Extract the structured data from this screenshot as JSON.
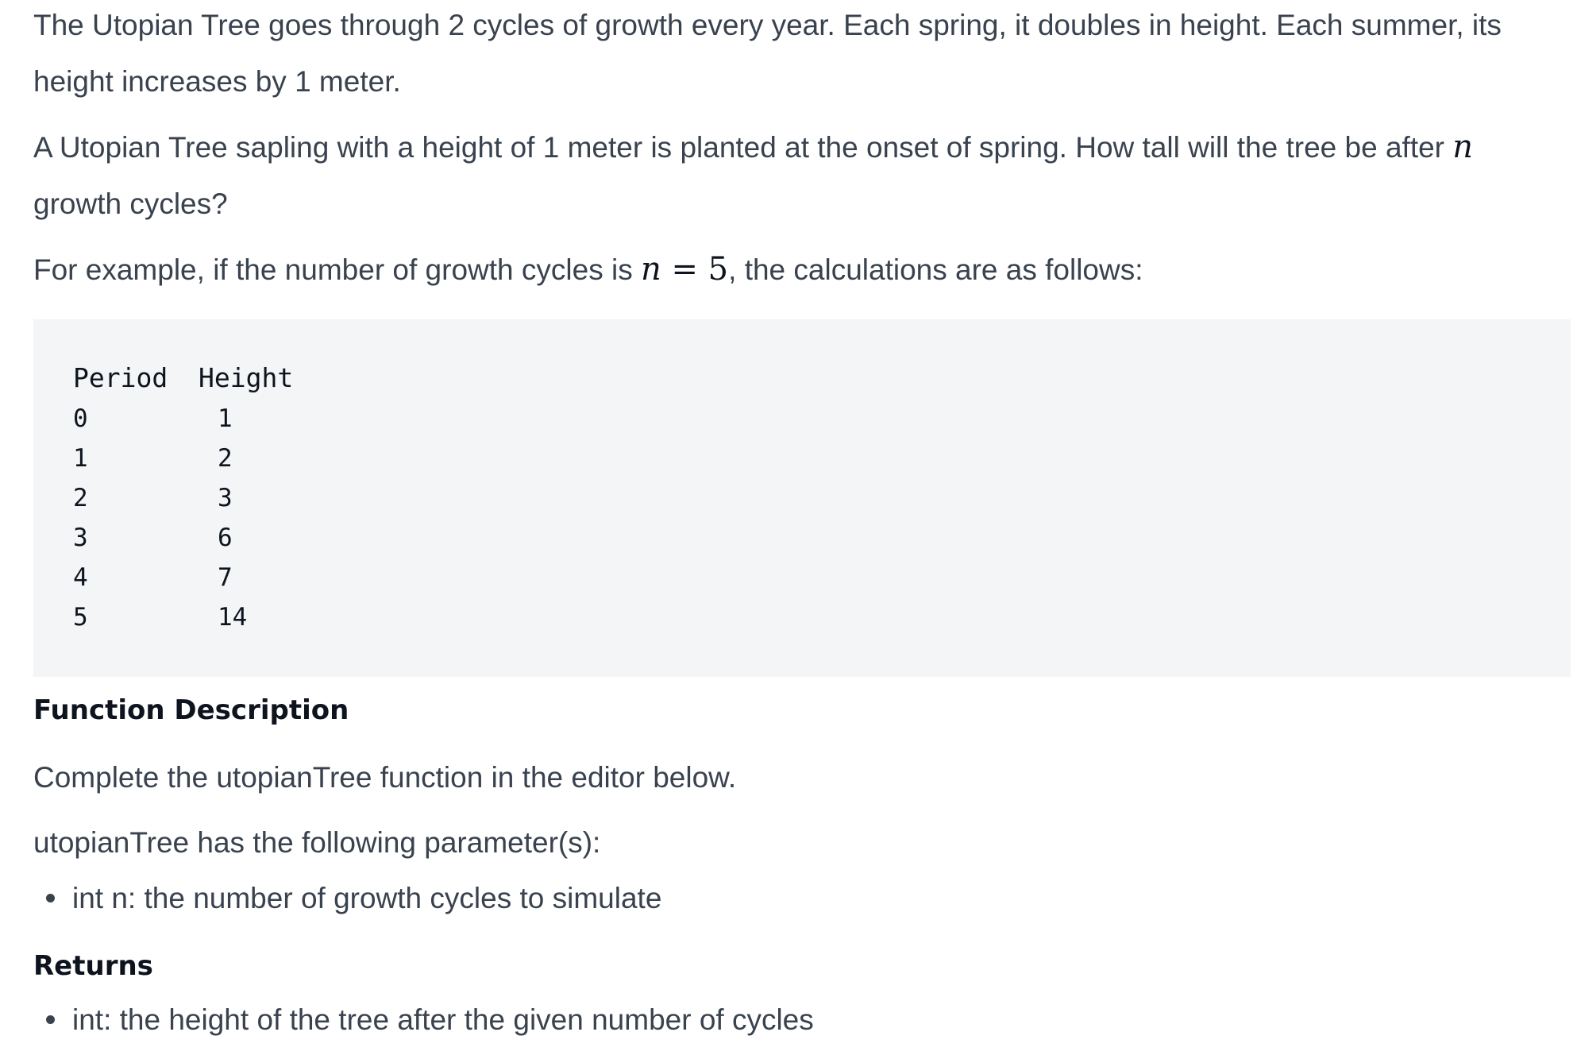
{
  "intro": {
    "p1": "The Utopian Tree goes through 2 cycles of growth every year. Each spring, it doubles in height. Each summer, its height increases by 1 meter.",
    "p2_before": "A Utopian Tree sapling with a height of 1 meter is planted at the onset of spring. How tall will the tree be after ",
    "p2_var": "n",
    "p2_after": " growth cycles?",
    "p3_before": "For example, if the number of growth cycles is ",
    "p3_var": "n",
    "p3_eq": " = 5",
    "p3_after": ", the calculations are as follows:"
  },
  "table": {
    "headers": [
      "Period",
      "Height"
    ],
    "rows": [
      [
        "0",
        "1"
      ],
      [
        "1",
        "2"
      ],
      [
        "2",
        "3"
      ],
      [
        "3",
        "6"
      ],
      [
        "4",
        "7"
      ],
      [
        "5",
        "14"
      ]
    ]
  },
  "function_description": {
    "heading": "Function Description",
    "line1": "Complete the utopianTree function in the editor below.",
    "line2": "utopianTree has the following parameter(s):",
    "params": [
      "int n: the number of growth cycles to simulate"
    ]
  },
  "returns": {
    "heading": "Returns",
    "items": [
      "int: the height of the tree after the given number of cycles"
    ]
  }
}
